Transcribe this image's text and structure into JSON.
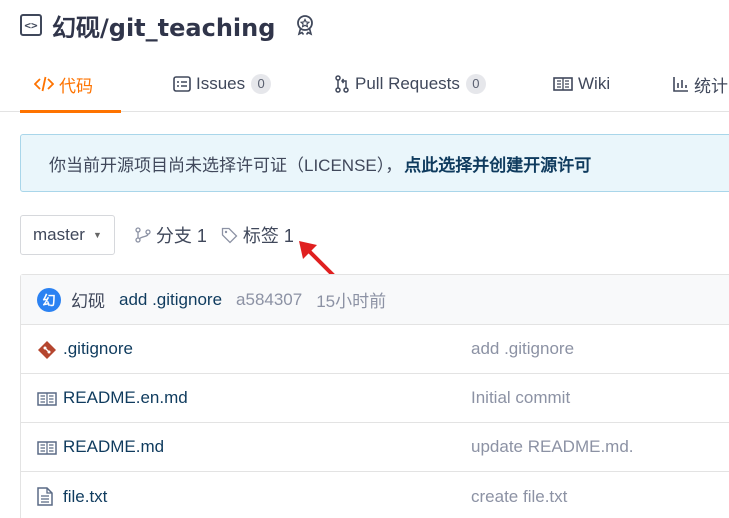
{
  "repo": {
    "title": "幻砚/git_teaching",
    "repo_icon": "code-repo-icon",
    "badge_icon": "award-icon"
  },
  "tabs": [
    {
      "label": "代码",
      "icon": "code-icon",
      "active": true
    },
    {
      "label": "Issues",
      "icon": "issues-icon",
      "count": "0"
    },
    {
      "label": "Pull Requests",
      "icon": "pull-request-icon",
      "count": "0"
    },
    {
      "label": "Wiki",
      "icon": "wiki-icon"
    },
    {
      "label": "统计",
      "icon": "stats-icon"
    }
  ],
  "license_banner": {
    "text": "你当前开源项目尚未选择许可证（LICENSE），",
    "link": "点此选择并创建开源许可"
  },
  "toolbar": {
    "branch": "master",
    "branches_label": "分支 1",
    "tags_label": "标签 1"
  },
  "commit": {
    "avatar_letter": "幻",
    "author": "幻砚",
    "message": "add .gitignore",
    "hash": "a584307",
    "time": "15小时前"
  },
  "files": [
    {
      "name": ".gitignore",
      "icon": "git-file-icon",
      "commit": "add .gitignore"
    },
    {
      "name": "README.en.md",
      "icon": "readme-book-icon",
      "commit": "Initial commit"
    },
    {
      "name": "README.md",
      "icon": "readme-book-icon",
      "commit": "update README.md."
    },
    {
      "name": "file.txt",
      "icon": "text-file-icon",
      "commit": "create file.txt"
    }
  ],
  "colors": {
    "accent": "#fe7300",
    "link": "#0f3b5e",
    "arrow": "#e02020",
    "banner_bg": "#eaf6fb"
  }
}
